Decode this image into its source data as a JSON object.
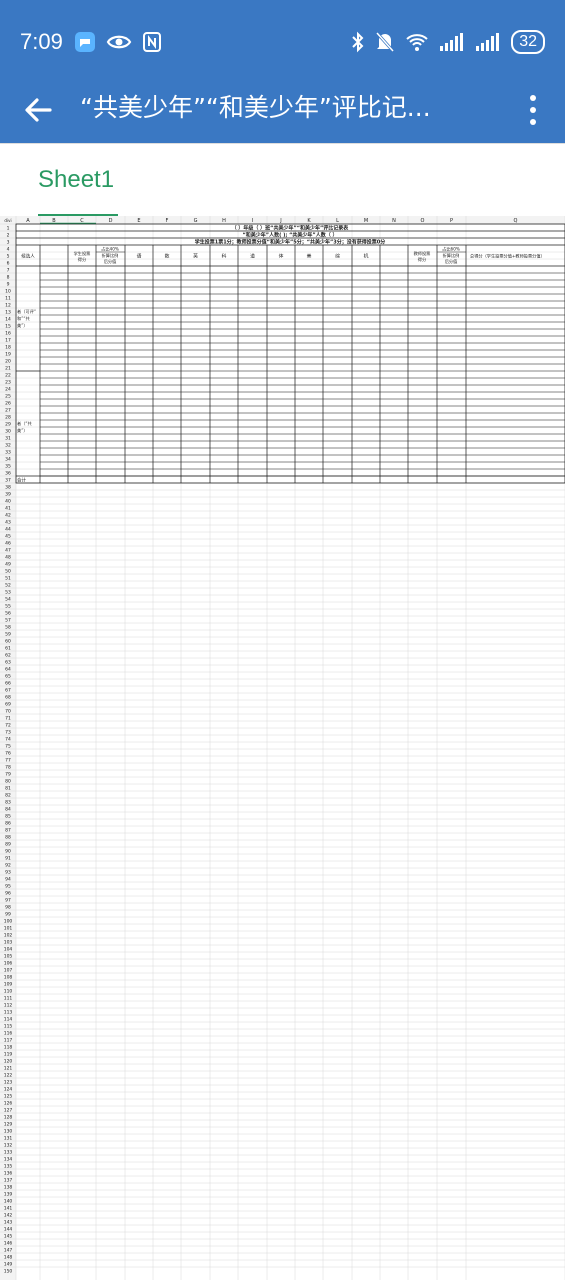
{
  "status_bar": {
    "time": "7:09",
    "battery": "32",
    "left_icons": [
      "chat-bubble-icon",
      "eye-icon",
      "nfc-icon"
    ],
    "right_icons": [
      "bluetooth-icon",
      "mute-bell-icon",
      "wifi-icon",
      "signal-icon",
      "signal-icon"
    ]
  },
  "toolbar": {
    "title": "“共美少年”“和美少年”评比记...",
    "back_icon": "arrow-back-icon",
    "more_icon": "more-vert-icon"
  },
  "sheet_tab": {
    "label": "Sheet1",
    "color": "#2a9a63"
  },
  "spreadsheet": {
    "column_letters": [
      "A",
      "B",
      "C",
      "D",
      "E",
      "F",
      "G",
      "H",
      "I",
      "J",
      "K",
      "L",
      "M",
      "N",
      "O",
      "P",
      "Q"
    ],
    "corner_label": "divi",
    "row_count": 150,
    "titles": [
      "（ ）年级（ ）班“共美少年”“和美少年”评比记录表",
      "“和美少年”人数(    ); “共美少年”人数（   ）",
      "学生投票1票1分；教师投票分值“和美少年”5分；“共美少年”3分；没有获得投票0分"
    ],
    "headers": {
      "candidate": "候选人",
      "student_score": "学生投票得分",
      "ratio_top_40": "占比40%",
      "ratio_bottom_40": "折算比例后分值",
      "subjects": [
        "语",
        "数",
        "英",
        "科",
        "道",
        "体",
        "美",
        "综",
        "机",
        ""
      ],
      "teacher_score": "教师投票得分",
      "ratio_top_60": "占比60%",
      "ratio_bottom_60": "折算比例后分值",
      "total": "总得分（学生投票分值+教师投票分值）"
    },
    "side_labels": {
      "group1": "者（可评“和”“共美”）",
      "group2": "者（“共美”）",
      "total_row": "合计"
    }
  }
}
